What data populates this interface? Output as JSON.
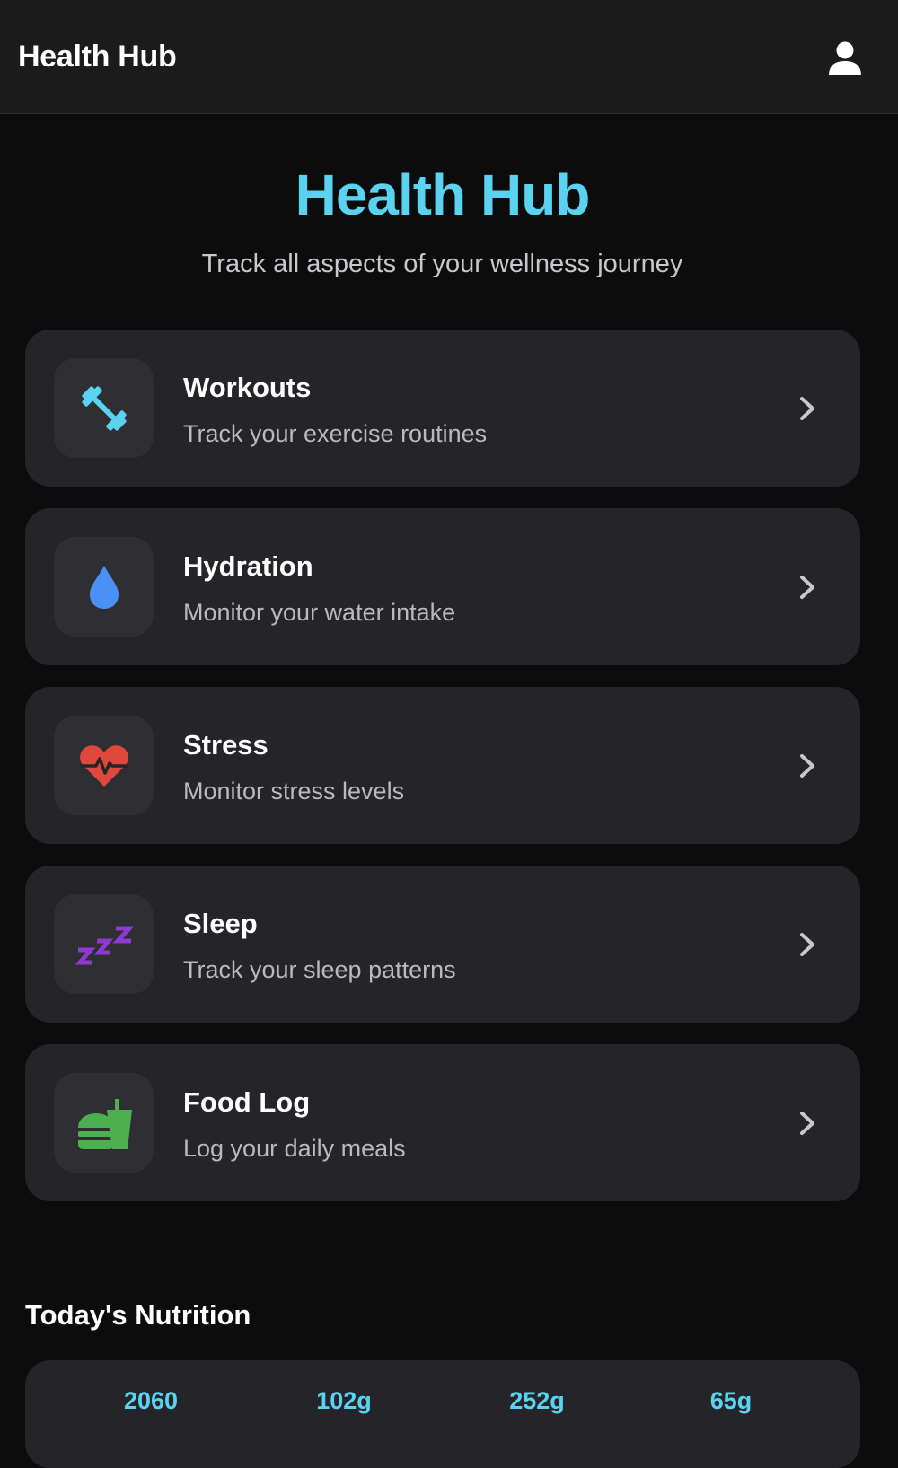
{
  "header": {
    "brand": "Health Hub"
  },
  "hero": {
    "title": "Health Hub",
    "subtitle": "Track all aspects of your wellness journey"
  },
  "categories": [
    {
      "title": "Workouts",
      "subtitle": "Track your exercise routines",
      "icon": "dumbbell-icon",
      "color": "#5ad3f0"
    },
    {
      "title": "Hydration",
      "subtitle": "Monitor your water intake",
      "icon": "water-drop-icon",
      "color": "#4a90f5"
    },
    {
      "title": "Stress",
      "subtitle": "Monitor stress levels",
      "icon": "heart-pulse-icon",
      "color": "#e0483e"
    },
    {
      "title": "Sleep",
      "subtitle": "Track your sleep patterns",
      "icon": "zzz-icon",
      "color": "#8e3ad0"
    },
    {
      "title": "Food Log",
      "subtitle": "Log your daily meals",
      "icon": "burger-drink-icon",
      "color": "#4caf50"
    }
  ],
  "nutrition": {
    "title": "Today's Nutrition",
    "values": [
      "2060",
      "102g",
      "252g",
      "65g"
    ]
  },
  "colors": {
    "accent": "#5ad3f0",
    "background": "#0c0c0d",
    "card": "#252429",
    "topbar": "#1b1b1c"
  }
}
